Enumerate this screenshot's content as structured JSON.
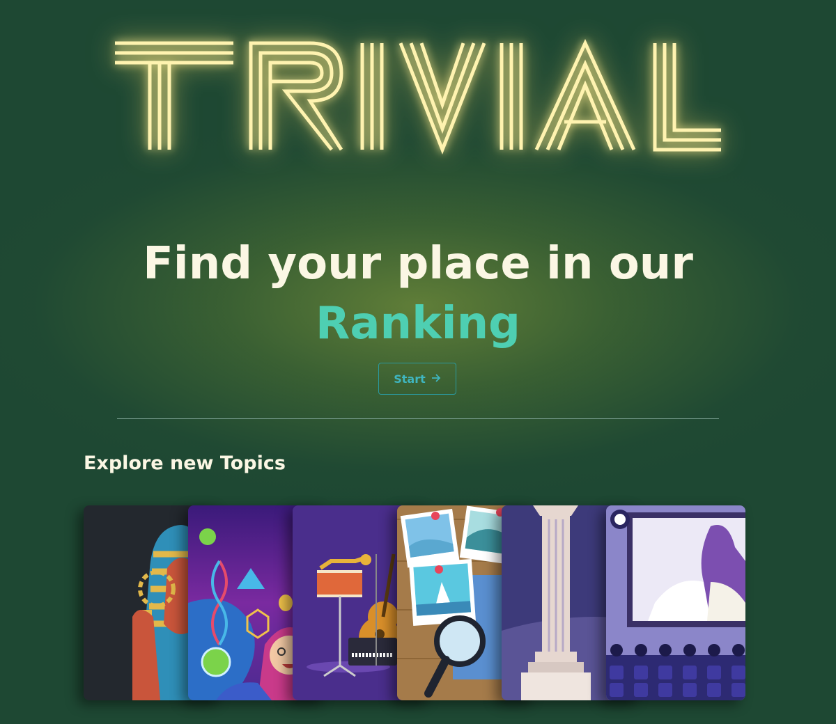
{
  "brand": {
    "logo_text": "TRIVIAL"
  },
  "hero": {
    "headline_line1": "Find your place in our",
    "headline_accent": "Ranking",
    "start_label": "Start",
    "start_icon": "arrow-right-icon"
  },
  "topics": {
    "title": "Explore new Topics",
    "cards": [
      {
        "icon": "history-pharaoh-illustration"
      },
      {
        "icon": "science-illustration"
      },
      {
        "icon": "music-illustration"
      },
      {
        "icon": "geography-photos-illustration"
      },
      {
        "icon": "art-column-illustration"
      },
      {
        "icon": "cinema-illustration"
      }
    ]
  },
  "colors": {
    "background": "#1e4833",
    "headline": "#fbf7e4",
    "accent": "#4ecfb2",
    "button": "#3fb6c0",
    "logo_neon": "#fff3b0"
  }
}
